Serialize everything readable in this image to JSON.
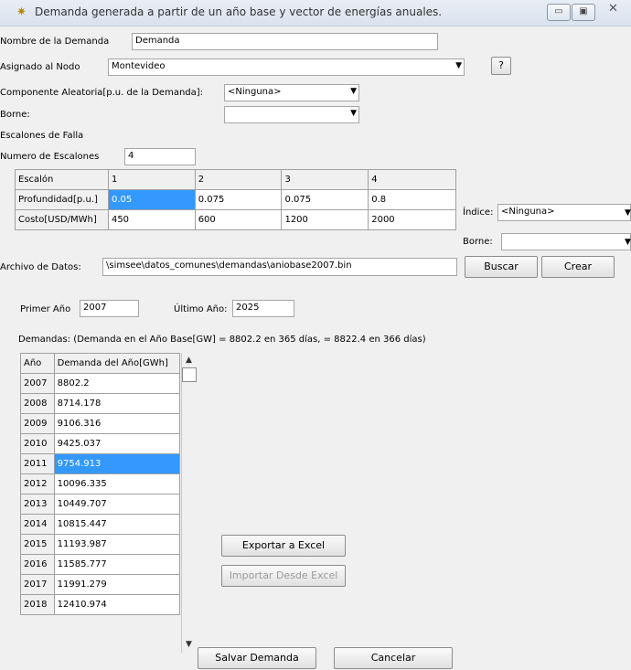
{
  "window": {
    "title": "Demanda generada a partir de un año base y vector de energías anuales.",
    "minimize_icon": "minimize-icon",
    "maximize_icon": "maximize-icon",
    "close_icon": "close-icon"
  },
  "form": {
    "nombre_label": "Nombre de la Demanda",
    "nombre_value": "Demanda",
    "nodo_label": "Asignado al Nodo",
    "nodo_value": "Montevideo",
    "help_button": "?",
    "componente_label": "Componente Aleatoria[p.u. de la Demanda]:",
    "componente_value": "<Ninguna>",
    "borne_label": "Borne:",
    "borne_value": "",
    "escalones_label": "Escalones de Falla",
    "numero_label": "Numero de Escalones",
    "numero_value": "4"
  },
  "escalones_table": {
    "header": [
      "Escalón",
      "1",
      "2",
      "3",
      "4"
    ],
    "rows": [
      [
        "Profundidad[p.u.]",
        "0.05",
        "0.075",
        "0.075",
        "0.8"
      ],
      [
        "Costo[USD/MWh]",
        "450",
        "600",
        "1200",
        "2000"
      ]
    ]
  },
  "indice": {
    "label": "Índice:",
    "value": "<Ninguna>",
    "borne_label": "Borne:",
    "borne_value": ""
  },
  "archivo": {
    "label": "Archivo de Datos:",
    "value": "\\simsee\\datos_comunes\\demandas\\aniobase2007.bin",
    "buscar": "Buscar",
    "crear": "Crear"
  },
  "years": {
    "primer_label": "Primer Año",
    "primer_value": "2007",
    "ultimo_label": "Último Año:",
    "ultimo_value": "2025"
  },
  "demandas": {
    "label": "Demandas: (Demanda en el Año Base[GW] = 8802.2 en 365 días, = 8822.4 en 366 días)",
    "col_year": "Año",
    "col_demand": "Demanda del Año[GWh]",
    "rows": [
      [
        "2007",
        "8802.2"
      ],
      [
        "2008",
        "8714.178"
      ],
      [
        "2009",
        "9106.316"
      ],
      [
        "2010",
        "9425.037"
      ],
      [
        "2011",
        "9754.913"
      ],
      [
        "2012",
        "10096.335"
      ],
      [
        "2013",
        "10449.707"
      ],
      [
        "2014",
        "10815.447"
      ],
      [
        "2015",
        "11193.987"
      ],
      [
        "2016",
        "11585.777"
      ],
      [
        "2017",
        "11991.279"
      ],
      [
        "2018",
        "12410.974"
      ]
    ],
    "selected_index": 4
  },
  "buttons": {
    "exportar": "Exportar a Excel",
    "importar": "Importar Desde Excel",
    "salvar": "Salvar Demanda",
    "cancelar": "Cancelar"
  }
}
